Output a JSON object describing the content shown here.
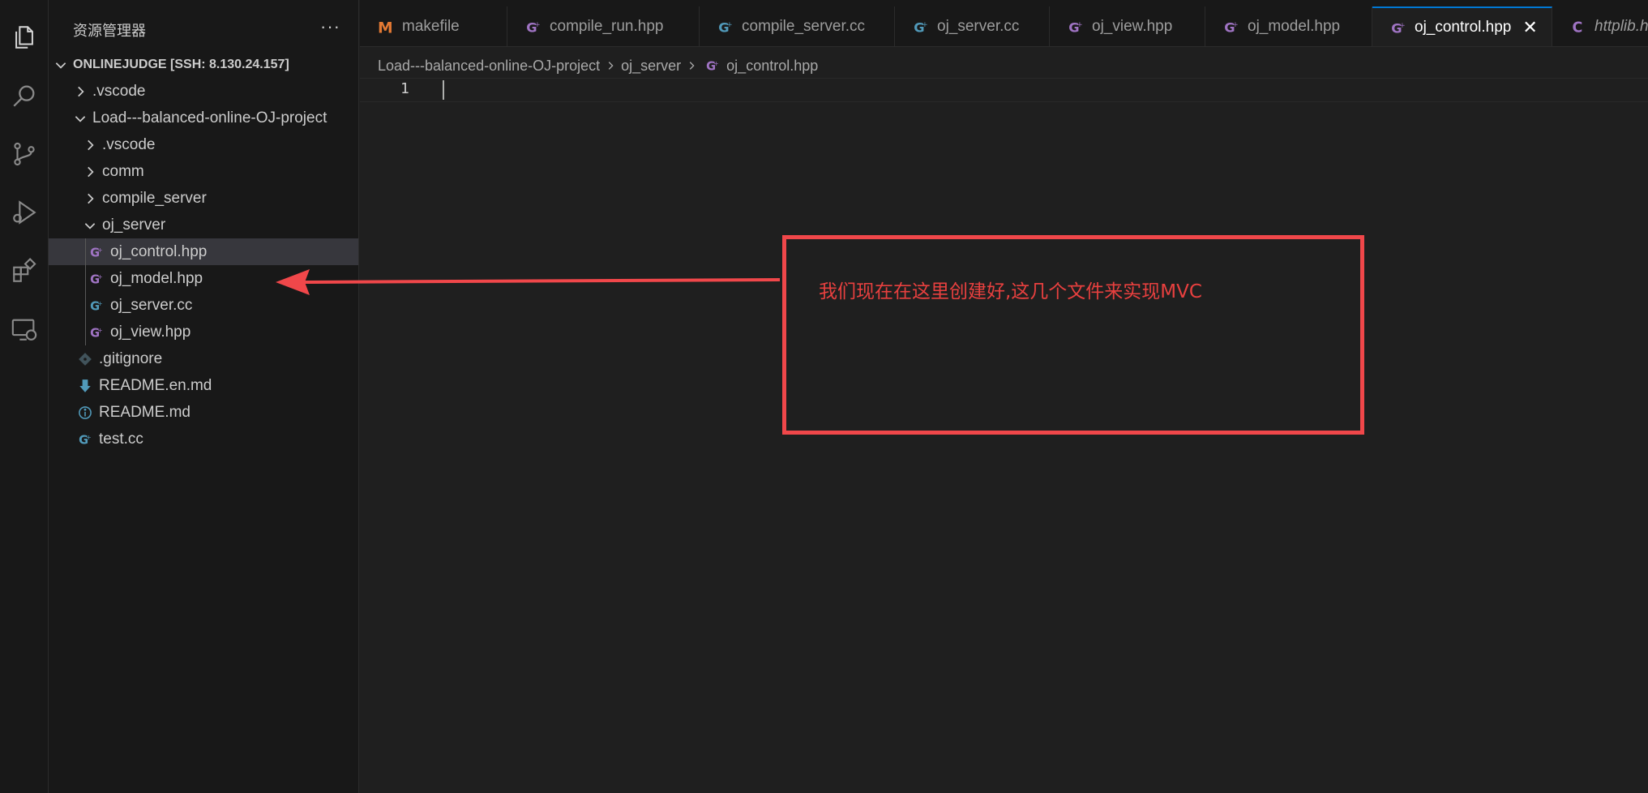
{
  "sidebar": {
    "title": "资源管理器",
    "more": "···",
    "root": "ONLINEJUDGE [SSH: 8.130.24.157]",
    "items": [
      {
        "label": ".vscode"
      },
      {
        "label": "Load---balanced-online-OJ-project"
      },
      {
        "label": ".vscode"
      },
      {
        "label": "comm"
      },
      {
        "label": "compile_server"
      },
      {
        "label": "oj_server"
      },
      {
        "label": "oj_control.hpp"
      },
      {
        "label": "oj_model.hpp"
      },
      {
        "label": "oj_server.cc"
      },
      {
        "label": "oj_view.hpp"
      },
      {
        "label": ".gitignore"
      },
      {
        "label": "README.en.md"
      },
      {
        "label": "README.md"
      },
      {
        "label": "test.cc"
      }
    ]
  },
  "tabs": [
    {
      "label": "makefile",
      "icon": "makefile-icon"
    },
    {
      "label": "compile_run.hpp",
      "icon": "cpp-header-icon"
    },
    {
      "label": "compile_server.cc",
      "icon": "cpp-source-icon"
    },
    {
      "label": "oj_server.cc",
      "icon": "cpp-source-icon"
    },
    {
      "label": "oj_view.hpp",
      "icon": "cpp-header-icon"
    },
    {
      "label": "oj_model.hpp",
      "icon": "cpp-header-icon"
    },
    {
      "label": "oj_control.hpp",
      "icon": "cpp-header-icon",
      "close": "✕"
    },
    {
      "label": "httplib.h",
      "icon": "c-header-icon"
    }
  ],
  "breadcrumb": {
    "parts": [
      "Load---balanced-online-OJ-project",
      "oj_server",
      "oj_control.hpp"
    ]
  },
  "editor": {
    "line_number": "1"
  },
  "annotation": {
    "text": "我们现在在这里创建好,这几个文件来实现MVC",
    "color": "#f0474a"
  },
  "colors": {
    "accent": "#0078d4",
    "hpp_icon": "#a074c4",
    "cc_icon": "#519aba",
    "makefile_icon": "#e37933"
  }
}
